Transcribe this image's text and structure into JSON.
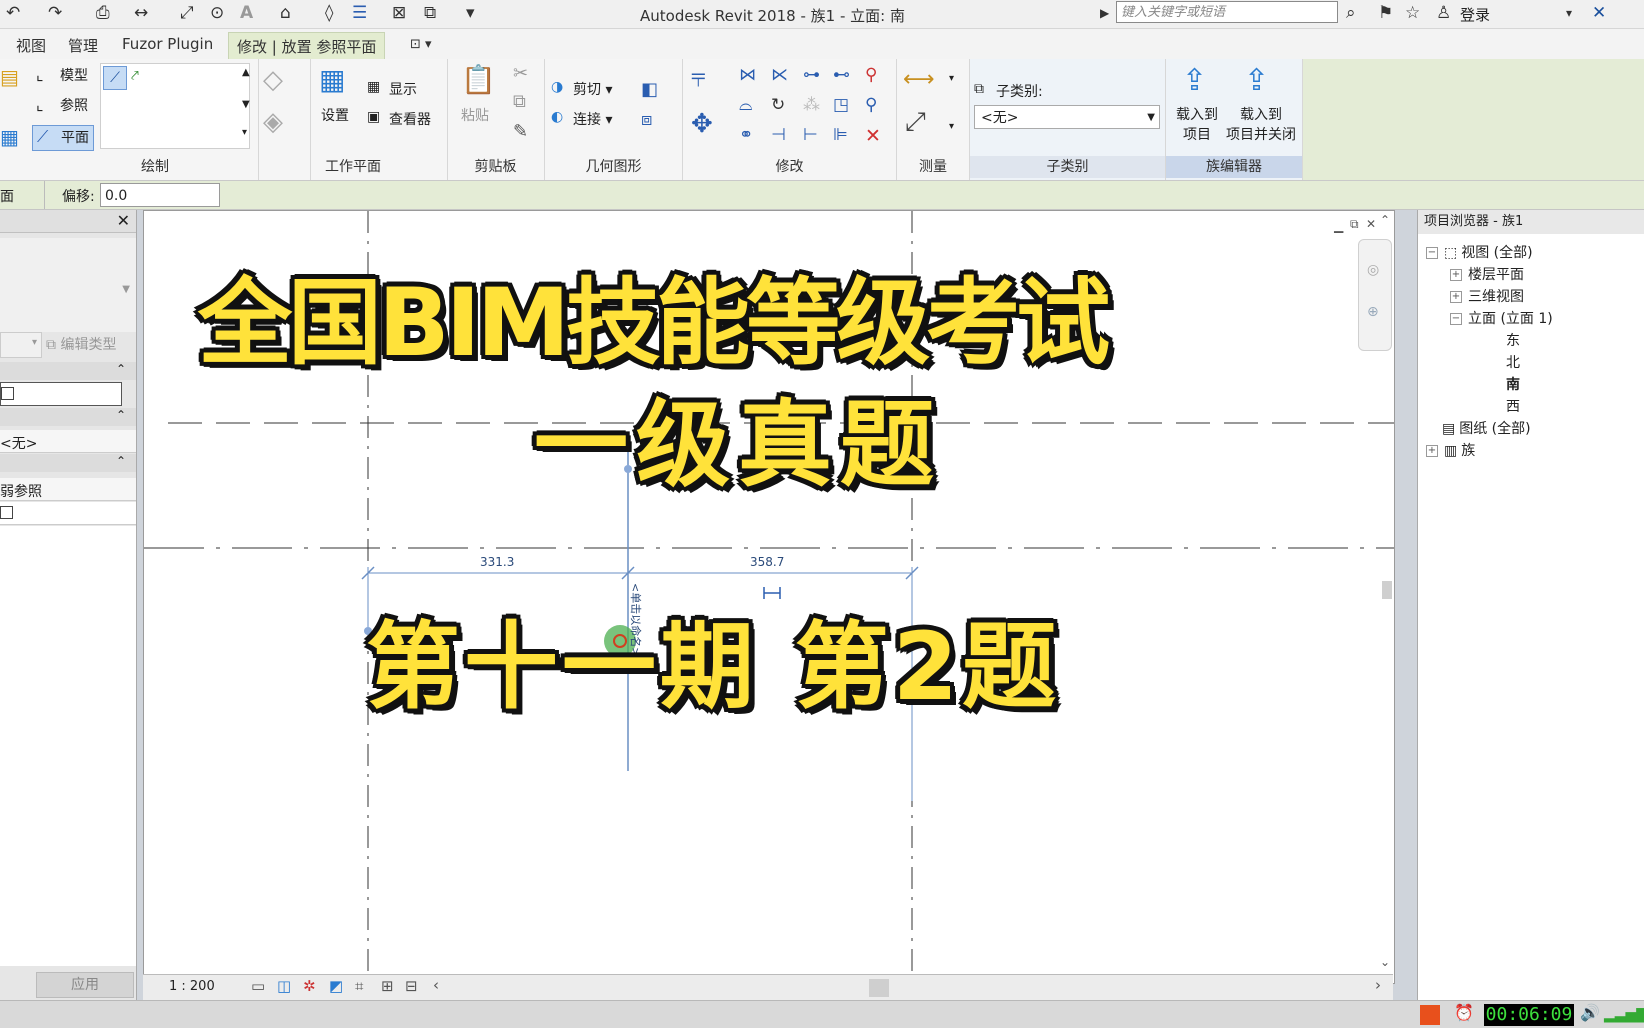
{
  "titlebar": {
    "app_title": "Autodesk Revit 2018 -    族1 - 立面: 南",
    "search_placeholder": "键入关键字或短语",
    "login": "登录"
  },
  "tabs": [
    "视图",
    "管理",
    "Fuzor Plugin",
    "修改 | 放置 参照平面"
  ],
  "ribbon": {
    "draw": {
      "label": "绘制",
      "model": "模型",
      "reference": "参照",
      "plane": "平面"
    },
    "workplane": {
      "label": "工作平面",
      "set": "设置",
      "show": "显示",
      "viewer": "查看器"
    },
    "clipboard": {
      "label": "剪贴板",
      "paste": "粘贴"
    },
    "geometry": {
      "label": "几何图形",
      "cut": "剪切",
      "join": "连接"
    },
    "modify": {
      "label": "修改"
    },
    "measure": {
      "label": "测量"
    },
    "subcategory": {
      "label": "子类别",
      "field_label": "子类别:",
      "value": "<无>"
    },
    "family_editor": {
      "label": "族编辑器",
      "load_project": "载入到\n项目",
      "load_close": "载入到\n项目并关闭"
    }
  },
  "options_bar": {
    "left_text": "面",
    "offset_label": "偏移:",
    "offset_value": "0.0"
  },
  "properties": {
    "edit_type": "编辑类型",
    "subcategory_value": "<无>",
    "weak_reference": "弱参照",
    "apply": "应用"
  },
  "canvas": {
    "dimension_left": "331.3",
    "dimension_right": "358.7",
    "unnamed_label": "<单击以命名>",
    "scale": "1 : 200"
  },
  "overlay": {
    "line1": "全国BIM技能等级考试",
    "line2": "一级真题",
    "line3": "第十一期 第2题"
  },
  "browser": {
    "title": "项目浏览器 - 族1",
    "views_all": "视图 (全部)",
    "floor_plans": "楼层平面",
    "views_3d": "三维视图",
    "elevations": "立面 (立面 1)",
    "east": "东",
    "north": "北",
    "south": "南",
    "west": "西",
    "sheets_all": "图纸 (全部)",
    "families": "族"
  },
  "status": {
    "timer": "00:06:09"
  }
}
